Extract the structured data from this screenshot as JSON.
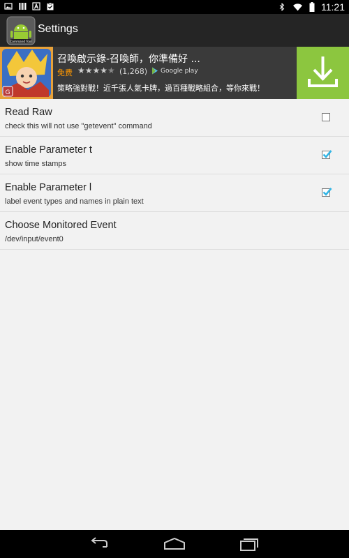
{
  "status_bar": {
    "time": "11:21",
    "left_icons": [
      "image-icon",
      "barcode-icon",
      "a-icon",
      "clipboard-check-icon"
    ],
    "right_icons": [
      "bluetooth-icon",
      "wifi-icon",
      "battery-icon"
    ]
  },
  "action_bar": {
    "app_icon_label": "Command Tool",
    "title": "Settings"
  },
  "ad": {
    "title": "召喚啟示錄-召喚師，你準備好 ...",
    "price": "免费",
    "rating": 4.5,
    "rating_count": "(1,268)",
    "store": "Google play",
    "description": "策略強對戰！近千張人氣卡牌，過百種戰略組合，等你來戰！",
    "colors": {
      "download_bg": "#8cc63f",
      "price": "#ff9800"
    }
  },
  "preferences": [
    {
      "title": "Read Raw",
      "summary": "check this will not use \"getevent\" command",
      "checkbox": true,
      "checked": false
    },
    {
      "title": "Enable Parameter t",
      "summary": "show time stamps",
      "checkbox": true,
      "checked": true
    },
    {
      "title": "Enable Parameter l",
      "summary": "label event types and names in plain text",
      "checkbox": true,
      "checked": true
    },
    {
      "title": "Choose Monitored Event",
      "summary": "/dev/input/event0",
      "checkbox": false,
      "checked": false
    }
  ],
  "nav_bar": {
    "buttons": [
      "back-icon",
      "home-icon",
      "recents-icon"
    ]
  },
  "colors": {
    "accent": "#33b5e5"
  }
}
